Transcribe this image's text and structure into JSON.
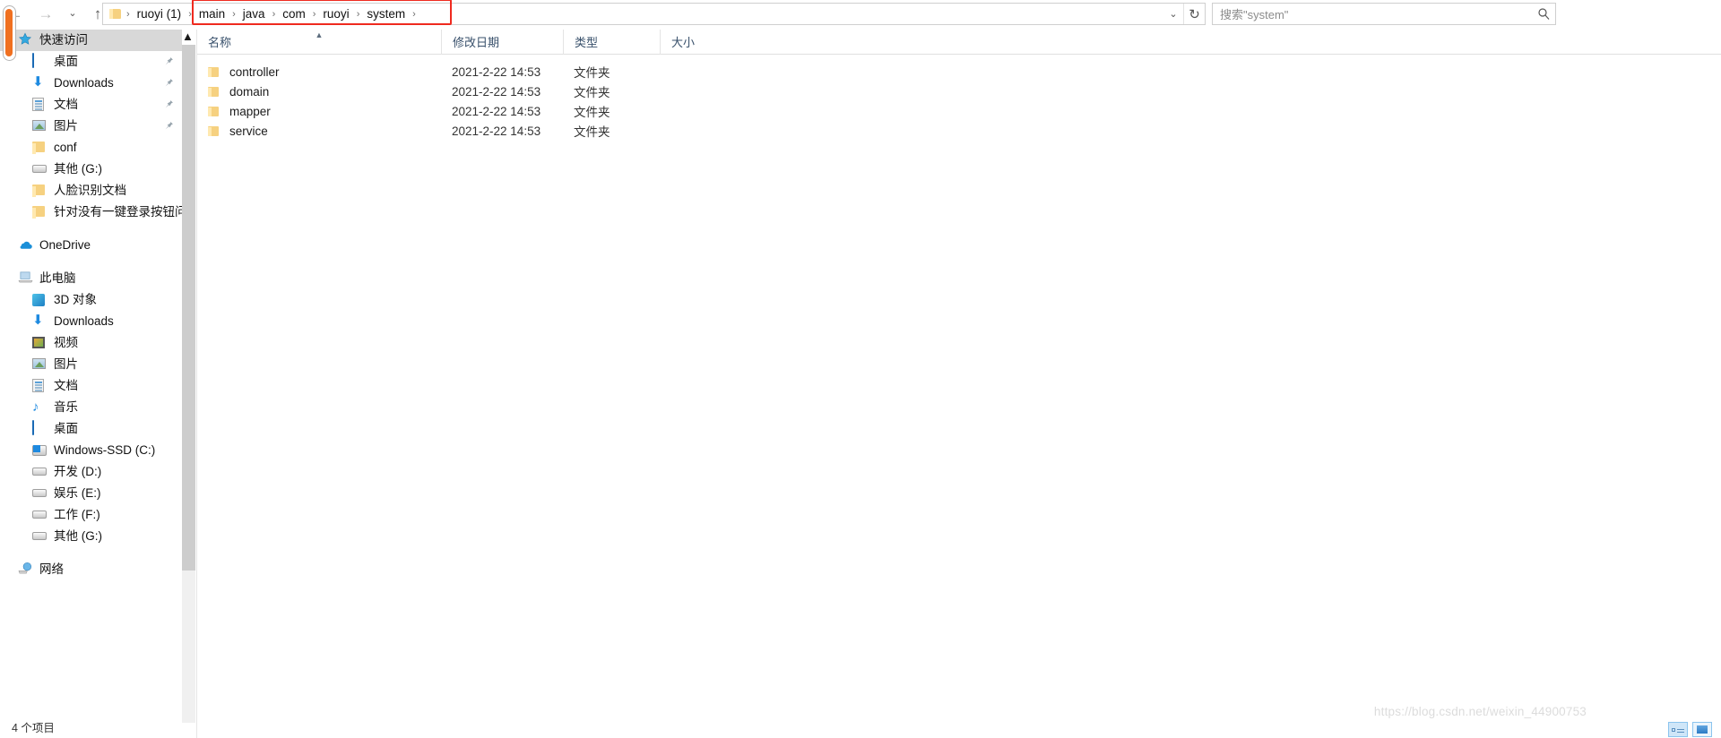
{
  "nav": {
    "back_icon": "arrow-left-icon",
    "forward_icon": "arrow-right-icon",
    "recent_icon": "chevron-down-icon",
    "up_icon": "arrow-up-icon",
    "address": {
      "root_icon": "folder-icon",
      "crumbs": [
        "ruoyi (1)",
        "main",
        "java",
        "com",
        "ruoyi",
        "system"
      ],
      "separator": "›",
      "dropdown_icon": "chevron-down-icon",
      "refresh_icon": "refresh-icon",
      "highlight_color": "#ef2a1f",
      "highlight_from": "main",
      "highlight_to": "system"
    },
    "search": {
      "placeholder": "搜索\"system\"",
      "value": "",
      "icon": "search-icon"
    }
  },
  "sidebar": {
    "scrollbar": {
      "up_icon": "chevron-up-icon",
      "down_icon": "chevron-down-icon"
    },
    "groups": [
      {
        "items": [
          {
            "label": "快速访问",
            "icon": "star-icon",
            "selected": true,
            "pinned": false,
            "indent": 0
          },
          {
            "label": "桌面",
            "icon": "desktop-icon",
            "selected": false,
            "pinned": true,
            "indent": 1
          },
          {
            "label": "Downloads",
            "icon": "download-icon",
            "selected": false,
            "pinned": true,
            "indent": 1
          },
          {
            "label": "文档",
            "icon": "document-icon",
            "selected": false,
            "pinned": true,
            "indent": 1
          },
          {
            "label": "图片",
            "icon": "picture-icon",
            "selected": false,
            "pinned": true,
            "indent": 1
          },
          {
            "label": "conf",
            "icon": "folder-icon",
            "selected": false,
            "pinned": false,
            "indent": 1
          },
          {
            "label": "其他 (G:)",
            "icon": "drive-icon",
            "selected": false,
            "pinned": false,
            "indent": 1
          },
          {
            "label": "人脸识别文档",
            "icon": "folder-icon",
            "selected": false,
            "pinned": false,
            "indent": 1
          },
          {
            "label": "针对没有一键登录按钮问题",
            "icon": "folder-icon",
            "selected": false,
            "pinned": false,
            "indent": 1
          }
        ]
      },
      {
        "items": [
          {
            "label": "OneDrive",
            "icon": "onedrive-icon",
            "selected": false,
            "pinned": false,
            "indent": 0
          }
        ]
      },
      {
        "items": [
          {
            "label": "此电脑",
            "icon": "this-pc-icon",
            "selected": false,
            "pinned": false,
            "indent": 0
          },
          {
            "label": "3D 对象",
            "icon": "3d-objects-icon",
            "selected": false,
            "pinned": false,
            "indent": 1
          },
          {
            "label": "Downloads",
            "icon": "download-icon",
            "selected": false,
            "pinned": false,
            "indent": 1
          },
          {
            "label": "视频",
            "icon": "video-icon",
            "selected": false,
            "pinned": false,
            "indent": 1
          },
          {
            "label": "图片",
            "icon": "picture-icon",
            "selected": false,
            "pinned": false,
            "indent": 1
          },
          {
            "label": "文档",
            "icon": "document-icon",
            "selected": false,
            "pinned": false,
            "indent": 1
          },
          {
            "label": "音乐",
            "icon": "music-icon",
            "selected": false,
            "pinned": false,
            "indent": 1
          },
          {
            "label": "桌面",
            "icon": "desktop-icon",
            "selected": false,
            "pinned": false,
            "indent": 1
          },
          {
            "label": "Windows-SSD (C:)",
            "icon": "windows-drive-icon",
            "selected": false,
            "pinned": false,
            "indent": 1
          },
          {
            "label": "开发 (D:)",
            "icon": "drive-icon",
            "selected": false,
            "pinned": false,
            "indent": 1
          },
          {
            "label": "娱乐 (E:)",
            "icon": "drive-icon",
            "selected": false,
            "pinned": false,
            "indent": 1
          },
          {
            "label": "工作 (F:)",
            "icon": "drive-icon",
            "selected": false,
            "pinned": false,
            "indent": 1
          },
          {
            "label": "其他 (G:)",
            "icon": "drive-icon",
            "selected": false,
            "pinned": false,
            "indent": 1
          }
        ]
      },
      {
        "items": [
          {
            "label": "网络",
            "icon": "network-icon",
            "selected": false,
            "pinned": false,
            "indent": 0
          }
        ]
      }
    ]
  },
  "filelist": {
    "columns": [
      {
        "label": "名称",
        "sorted": true,
        "sort_caret": "▲"
      },
      {
        "label": "修改日期",
        "sorted": false,
        "sort_caret": ""
      },
      {
        "label": "类型",
        "sorted": false,
        "sort_caret": ""
      },
      {
        "label": "大小",
        "sorted": false,
        "sort_caret": ""
      }
    ],
    "rows": [
      {
        "name": "controller",
        "date": "2021-2-22 14:53",
        "type": "文件夹",
        "size": "",
        "icon": "folder-icon"
      },
      {
        "name": "domain",
        "date": "2021-2-22 14:53",
        "type": "文件夹",
        "size": "",
        "icon": "folder-icon"
      },
      {
        "name": "mapper",
        "date": "2021-2-22 14:53",
        "type": "文件夹",
        "size": "",
        "icon": "folder-icon"
      },
      {
        "name": "service",
        "date": "2021-2-22 14:53",
        "type": "文件夹",
        "size": "",
        "icon": "folder-icon"
      }
    ]
  },
  "statusbar": {
    "item_count": "4 个项目"
  },
  "watermark": {
    "text": "https://blog.csdn.net/weixin_44900753"
  },
  "view_buttons": [
    {
      "name": "details-view-button",
      "active": true
    },
    {
      "name": "large-icons-view-button",
      "active": false
    }
  ]
}
